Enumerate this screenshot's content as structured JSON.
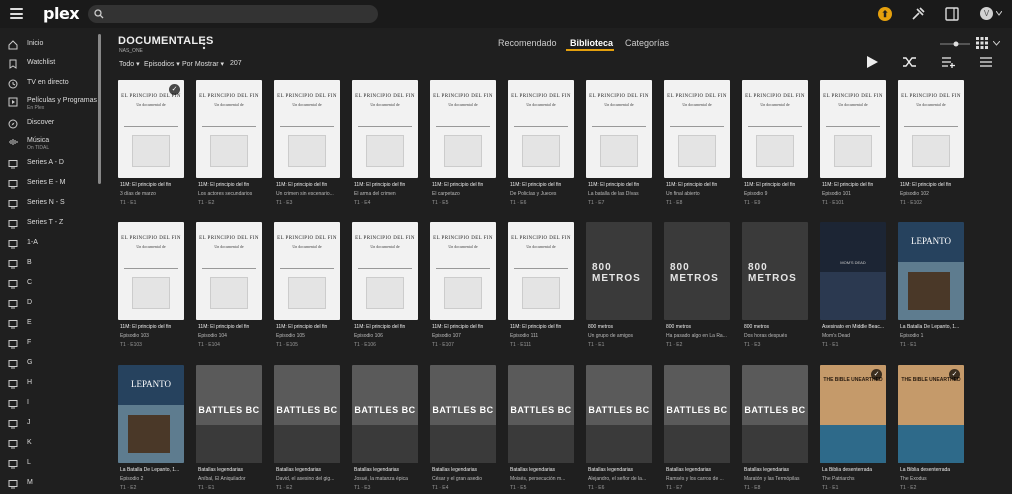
{
  "topbar": {
    "search_placeholder": ""
  },
  "sidebar": {
    "items": [
      {
        "label": "Inicio",
        "sub": ""
      },
      {
        "label": "Watchlist",
        "sub": ""
      },
      {
        "label": "TV en directo",
        "sub": ""
      },
      {
        "label": "Películas y Programas",
        "sub": "En Plex"
      },
      {
        "label": "Discover",
        "sub": ""
      },
      {
        "label": "Música",
        "sub": "On TIDAL"
      },
      {
        "label": "Series A - D",
        "sub": ""
      },
      {
        "label": "Series E - M",
        "sub": ""
      },
      {
        "label": "Series N - S",
        "sub": ""
      },
      {
        "label": "Series T - Z",
        "sub": ""
      },
      {
        "label": "1-A",
        "sub": ""
      },
      {
        "label": "B",
        "sub": ""
      },
      {
        "label": "C",
        "sub": ""
      },
      {
        "label": "D",
        "sub": ""
      },
      {
        "label": "E",
        "sub": ""
      },
      {
        "label": "F",
        "sub": ""
      },
      {
        "label": "G",
        "sub": ""
      },
      {
        "label": "H",
        "sub": ""
      },
      {
        "label": "I",
        "sub": ""
      },
      {
        "label": "J",
        "sub": ""
      },
      {
        "label": "K",
        "sub": ""
      },
      {
        "label": "L",
        "sub": ""
      },
      {
        "label": "M",
        "sub": ""
      }
    ]
  },
  "library": {
    "title": "DOCUMENTALES",
    "server": "NAS_ONE"
  },
  "filters": {
    "all": "Todo",
    "type": "Episodios",
    "sort": "Por Mostrar",
    "count": "207"
  },
  "tabs": [
    "Recomendado",
    "Biblioteca",
    "Categorías"
  ],
  "poster_text": {
    "principio_title": "EL PRINCIPIO DEL FIN",
    "principio_sub": "Un documental de",
    "eight": "800 METROS",
    "lepanto": "LEPANTO",
    "battles": "BATTLES BC",
    "bible": "THE BIBLE UNEARTHED",
    "moms": "MOM'S DEAD"
  },
  "rows": [
    [
      {
        "t": "11M: El principio del fin",
        "s": "3 días de marzo",
        "e": "T1 · E1",
        "p": "white",
        "w": true
      },
      {
        "t": "11M: El principio del fin",
        "s": "Los actores secundarios",
        "e": "T1 · E2",
        "p": "white"
      },
      {
        "t": "11M: El principio del fin",
        "s": "Un crimen sin escenario...",
        "e": "T1 · E3",
        "p": "white"
      },
      {
        "t": "11M: El principio del fin",
        "s": "El arma del crimen",
        "e": "T1 · E4",
        "p": "white"
      },
      {
        "t": "11M: El principio del fin",
        "s": "El carpetazo",
        "e": "T1 · E5",
        "p": "white"
      },
      {
        "t": "11M: El principio del fin",
        "s": "De Policías y Jueces",
        "e": "T1 · E6",
        "p": "white"
      },
      {
        "t": "11M: El principio del fin",
        "s": "La batalla de las Dívas",
        "e": "T1 · E7",
        "p": "white"
      },
      {
        "t": "11M: El principio del fin",
        "s": "Un final abierto",
        "e": "T1 · E8",
        "p": "white"
      },
      {
        "t": "11M: El principio del fin",
        "s": "Episodio 9",
        "e": "T1 · E9",
        "p": "white"
      },
      {
        "t": "11M: El principio del fin",
        "s": "Episodio 101",
        "e": "T1 · E101",
        "p": "white"
      },
      {
        "t": "11M: El principio del fin",
        "s": "Episodio 102",
        "e": "T1 · E102",
        "p": "white"
      }
    ],
    [
      {
        "t": "11M: El principio del fin",
        "s": "Episodio 103",
        "e": "T1 · E103",
        "p": "white"
      },
      {
        "t": "11M: El principio del fin",
        "s": "Episodio 104",
        "e": "T1 · E104",
        "p": "white"
      },
      {
        "t": "11M: El principio del fin",
        "s": "Episodio 105",
        "e": "T1 · E105",
        "p": "white"
      },
      {
        "t": "11M: El principio del fin",
        "s": "Episodio 106",
        "e": "T1 · E106",
        "p": "white"
      },
      {
        "t": "11M: El principio del fin",
        "s": "Episodio 107",
        "e": "T1 · E107",
        "p": "white"
      },
      {
        "t": "11M: El principio del fin",
        "s": "Episodio 111",
        "e": "T1 · E111",
        "p": "white"
      },
      {
        "t": "800 metros",
        "s": "Un grupo de amigos",
        "e": "T1 · E1",
        "p": "800"
      },
      {
        "t": "800 metros",
        "s": "Ha pasado algo en La Ra...",
        "e": "T1 · E2",
        "p": "800"
      },
      {
        "t": "800 metros",
        "s": "Dos horas después",
        "e": "T1 · E3",
        "p": "800"
      },
      {
        "t": "Asesinato en Middle Beac...",
        "s": "Mom's Dead",
        "e": "T1 · E1",
        "p": "mom"
      },
      {
        "t": "La Batalla De Lepanto, 1...",
        "s": "Episodio 1",
        "e": "T1 · E1",
        "p": "lep"
      }
    ],
    [
      {
        "t": "La Batalla De Lepanto, 1...",
        "s": "Episodio 2",
        "e": "T1 · E2",
        "p": "lep"
      },
      {
        "t": "Batallas legendarias",
        "s": "Aníbal, El Aniquilador",
        "e": "T1 · E1",
        "p": "bat"
      },
      {
        "t": "Batallas legendarias",
        "s": "David, el asesino del gig...",
        "e": "T1 · E2",
        "p": "bat"
      },
      {
        "t": "Batallas legendarias",
        "s": "Josué, la matanza épica",
        "e": "T1 · E3",
        "p": "bat"
      },
      {
        "t": "Batallas legendarias",
        "s": "César y el gran asedio",
        "e": "T1 · E4",
        "p": "bat"
      },
      {
        "t": "Batallas legendarias",
        "s": "Moisés, persecución m...",
        "e": "T1 · E5",
        "p": "bat"
      },
      {
        "t": "Batallas legendarias",
        "s": "Alejandro, el señor de la...",
        "e": "T1 · E6",
        "p": "bat"
      },
      {
        "t": "Batallas legendarias",
        "s": "Ramsés y los carros de ...",
        "e": "T1 · E7",
        "p": "bat"
      },
      {
        "t": "Batallas legendarias",
        "s": "Maratón y las Termópilas",
        "e": "T1 · E8",
        "p": "bat"
      },
      {
        "t": "La Biblia desenterrada",
        "s": "The Patriarchs",
        "e": "T1 · E1",
        "p": "bib",
        "w": true
      },
      {
        "t": "La Biblia desenterrada",
        "s": "The Exodus",
        "e": "T1 · E2",
        "p": "bib",
        "w": true
      }
    ]
  ]
}
